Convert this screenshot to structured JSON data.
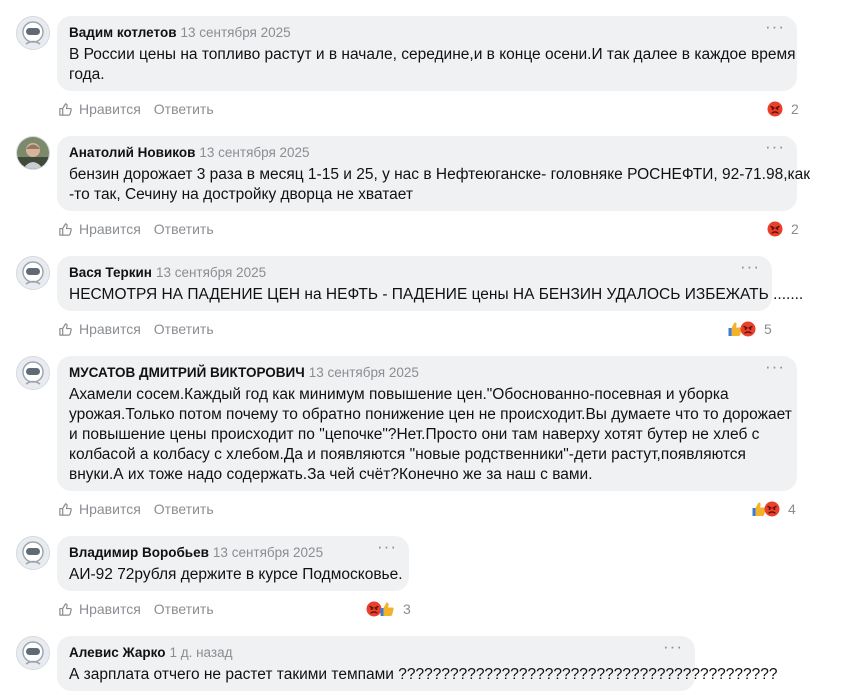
{
  "actions": {
    "like_label": "Нравится",
    "reply_label": "Ответить",
    "more_label": "···"
  },
  "colors": {
    "bubble": "#eff1f3",
    "muted": "#8a8d92",
    "angry": "#e8402a",
    "thumb": "#f2b32b"
  },
  "comments": [
    {
      "author": "Вадим котлетов",
      "date": "13 сентября 2025",
      "lines": [
        "В России цены на топливо растут и в начале, середине,и в конце осени.И так далее в каждое время",
        "года."
      ],
      "reactions": [
        "angry"
      ],
      "reaction_count": "2",
      "avatar": "default-avatar"
    },
    {
      "author": "Анатолий Новиков",
      "date": "13 сентября 2025",
      "lines": [
        "бензин дорожает 3 раза в месяц 1-15 и 25, у нас в Нефтеюганске- головняке РОСНЕФТИ, 92-71.98,как",
        "-то так, Сечину на достройку дворца не хватает"
      ],
      "reactions": [
        "angry"
      ],
      "reaction_count": "2",
      "avatar": "photo-avatar"
    },
    {
      "author": "Вася Теркин",
      "date": "13 сентября 2025",
      "lines": [
        "НЕСМОТРЯ НА ПАДЕНИЕ ЦЕН на НЕФТЬ - ПАДЕНИЕ цены НА БЕНЗИН УДАЛОСЬ ИЗБЕЖАТЬ ......."
      ],
      "reactions": [
        "thumb",
        "angry"
      ],
      "reaction_count": "5",
      "avatar": "default-avatar"
    },
    {
      "author": "МУСАТОВ ДМИТРИЙ ВИКТОРОВИЧ",
      "date": "13 сентября 2025",
      "lines": [
        "Ахамели сосем.Каждый год как минимум повышение цен.\"Обоснованно-посевная и уборка",
        "урожая.Только потом почему то обратно понижение цен не происходит.Вы думаете что то дорожает",
        "и повышение цены происходит по \"цепочке\"?Нет.Просто они там наверху хотят бутер не хлеб с",
        "колбасой а колбасу с хлебом.Да и появляются \"новые родственники\"-дети растут,появляются",
        "внуки.А их тоже надо содержать.За чей счёт?Конечно же за наш с вами."
      ],
      "reactions": [
        "thumb",
        "angry"
      ],
      "reaction_count": "4",
      "avatar": "default-avatar"
    },
    {
      "author": "Владимир Воробьев",
      "date": "13 сентября 2025",
      "lines": [
        "АИ-92 72рубля держите в курсе Подмосковье."
      ],
      "reactions": [
        "angry",
        "thumb"
      ],
      "reaction_count": "3",
      "avatar": "default-avatar"
    },
    {
      "author": "Алевис Жарко",
      "date": "1 д. назад",
      "lines": [
        "А зарплата отчего не растет такими темпами ????????????????????????????????????????????"
      ],
      "reactions": [],
      "reaction_count": "",
      "avatar": "default-avatar"
    }
  ]
}
